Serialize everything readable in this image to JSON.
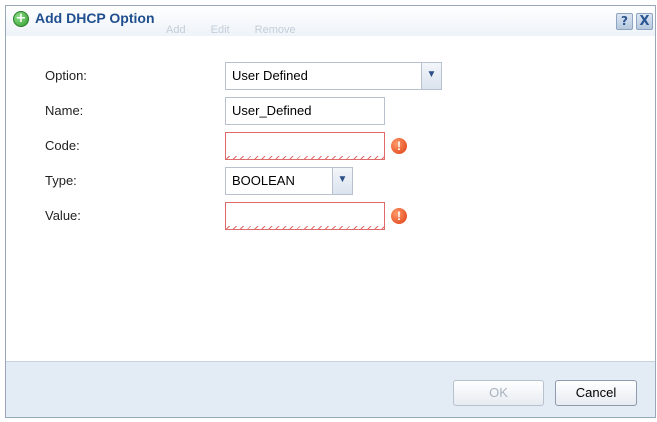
{
  "dialog": {
    "title": "Add DHCP Option",
    "toolbar_ghost": [
      "Add",
      "Edit",
      "Remove"
    ],
    "help_label": "?",
    "close_label": "X"
  },
  "form": {
    "option_label": "Option:",
    "option_value": "User Defined",
    "name_label": "Name:",
    "name_value": "User_Defined",
    "code_label": "Code:",
    "code_value": "",
    "type_label": "Type:",
    "type_value": "BOOLEAN",
    "value_label": "Value:",
    "value_value": "",
    "error_glyph": "!"
  },
  "footer": {
    "ok_label": "OK",
    "cancel_label": "Cancel"
  },
  "colors": {
    "title_blue": "#1f4f8e",
    "footer_bg": "#e3ebf5",
    "error_red": "#e06a6a"
  }
}
